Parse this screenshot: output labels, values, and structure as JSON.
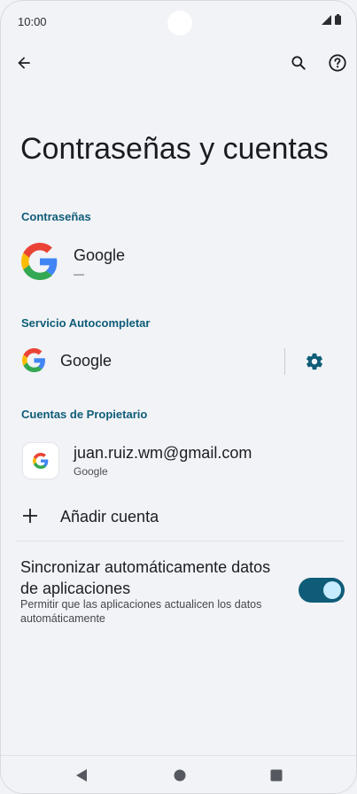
{
  "status": {
    "time": "10:00"
  },
  "header": {
    "title": "Contraseñas y cuentas"
  },
  "passwords": {
    "header": "Contraseñas",
    "provider_name": "Google",
    "provider_status": "—"
  },
  "autofill": {
    "header": "Servicio Autocompletar",
    "provider_name": "Google"
  },
  "owner_accounts": {
    "header": "Cuentas de Propietario",
    "account_email": "juan.ruiz.wm@gmail.com",
    "account_type": "Google",
    "add_account_label": "Añadir cuenta"
  },
  "sync": {
    "title": "Sincronizar automáticamente datos de aplicaciones",
    "subtitle": "Permitir que las aplicaciones actualicen los datos automáticamente",
    "enabled": true
  },
  "icons": {
    "back": "arrow-back-icon",
    "search": "search-icon",
    "help": "help-icon",
    "settings": "gear-icon",
    "add": "plus-icon"
  },
  "colors": {
    "accent": "#0f5c78",
    "toggle_knob": "#c6ecff",
    "background": "#f1f3f6"
  }
}
